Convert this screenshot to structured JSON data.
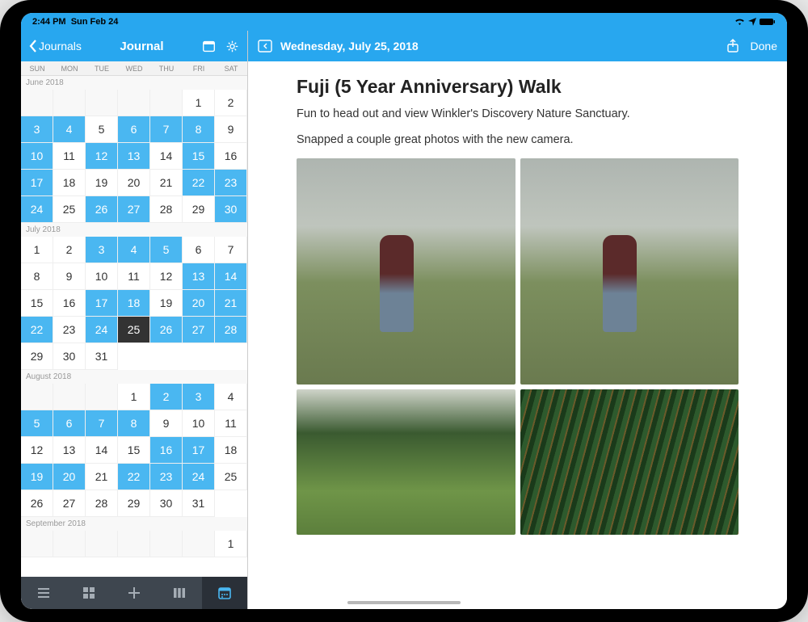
{
  "status": {
    "time": "2:44 PM",
    "date": "Sun Feb 24"
  },
  "sidebar": {
    "back_label": "Journals",
    "title": "Journal",
    "weekdays": [
      "SUN",
      "MON",
      "TUE",
      "WED",
      "THU",
      "FRI",
      "SAT"
    ],
    "months": [
      {
        "label": "June 2018",
        "offset": 5,
        "days": 30,
        "highlighted": [
          3,
          4,
          6,
          7,
          8,
          10,
          12,
          13,
          15,
          17,
          22,
          23,
          24,
          26,
          27,
          30
        ],
        "selected": null
      },
      {
        "label": "July 2018",
        "offset": 0,
        "days": 31,
        "highlighted": [
          3,
          4,
          5,
          13,
          14,
          17,
          18,
          20,
          21,
          22,
          24,
          26,
          27,
          28
        ],
        "selected": 25
      },
      {
        "label": "August 2018",
        "offset": 3,
        "days": 31,
        "highlighted": [
          2,
          3,
          5,
          6,
          7,
          8,
          16,
          17,
          19,
          20,
          22,
          23,
          24
        ],
        "selected": null
      },
      {
        "label": "September 2018",
        "offset": 6,
        "days": 1,
        "highlighted": [],
        "selected": null
      }
    ]
  },
  "content": {
    "date_label": "Wednesday, July 25, 2018",
    "done_label": "Done",
    "title": "Fuji (5 Year Anniversary) Walk",
    "p1": "Fun to head out and view Winkler's Discovery Nature Sanctuary.",
    "p2": "Snapped a couple great photos with the new camera."
  }
}
